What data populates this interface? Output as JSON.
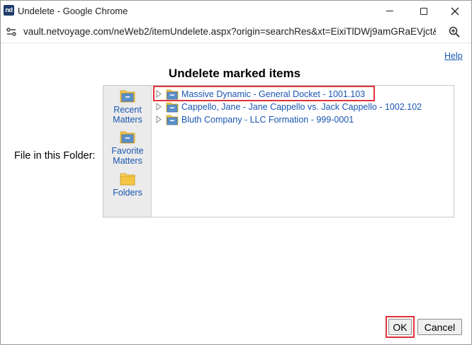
{
  "window": {
    "title": "Undelete - Google Chrome",
    "app_icon_text": "nd",
    "controls": {
      "minimize": "minimize-icon",
      "maximize": "maximize-icon",
      "close": "close-icon"
    }
  },
  "addressbar": {
    "site_icon": "site-settings-icon",
    "url": "vault.netvoyage.com/neWeb2/itemUndelete.aspx?origin=searchRes&xt=EixiTlDWj9amGRaEVjct&cabG...",
    "zoom_icon": "zoom-icon"
  },
  "page": {
    "help": "Help",
    "title": "Undelete marked items",
    "folder_label": "File in this Folder:"
  },
  "picker": {
    "sidebar": [
      {
        "label_line1": "Recent",
        "label_line2": "Matters",
        "icon": "recent-matters-icon"
      },
      {
        "label_line1": "Favorite",
        "label_line2": "Matters",
        "icon": "favorite-matters-icon"
      },
      {
        "label_line1": "Folders",
        "label_line2": "",
        "icon": "folders-icon"
      }
    ],
    "items": [
      {
        "label": "Massive Dynamic - General Docket - 1001.103",
        "highlighted": true
      },
      {
        "label": "Cappello, Jane - Jane Cappello vs. Jack Cappello - 1002.102",
        "highlighted": false
      },
      {
        "label": "Bluth Company - LLC Formation - 999-0001",
        "highlighted": false
      }
    ]
  },
  "buttons": {
    "ok": "OK",
    "cancel": "Cancel"
  },
  "colors": {
    "link": "#1a56b0",
    "highlight": "#e0343b",
    "sidebar_bg": "#ebebeb",
    "matter_folder": "#5b8fc9",
    "folder_yellow": "#f4c542"
  }
}
